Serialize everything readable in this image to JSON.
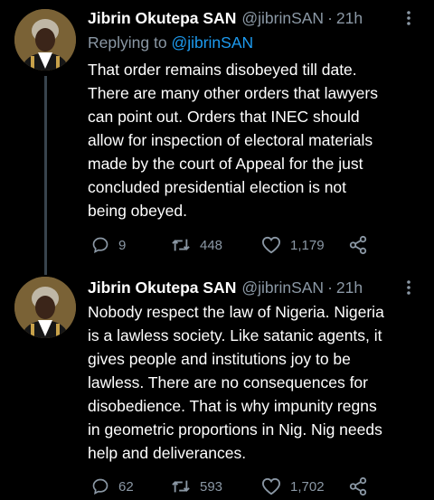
{
  "tweets": [
    {
      "author": {
        "name": "Jibrin Okutepa SAN",
        "handle": "@jibrinSAN"
      },
      "separator": "·",
      "time": "21h",
      "replying_to": {
        "prefix": "Replying to",
        "handle": "@jibrinSAN"
      },
      "text": "That order remains disobeyed till date.\nThere are many other orders that lawyers\ncan point out. Orders that INEC should\nallow for inspection of electoral materials\nmade by the court of Appeal for the just\nconcluded presidential election is not\nbeing obeyed.",
      "stats": {
        "replies": "9",
        "retweets": "448",
        "likes": "1,179"
      }
    },
    {
      "author": {
        "name": "Jibrin Okutepa SAN",
        "handle": "@jibrinSAN"
      },
      "separator": "·",
      "time": "21h",
      "text": "Nobody respect the law of Nigeria. Nigeria\nis a lawless society. Like satanic agents, it\ngives people and institutions joy to be\nlawless. There are no consequences for\ndisobedience. That is why impunity regns\nin geometric proportions in Nig. Nig needs\nhelp and deliverances.",
      "stats": {
        "replies": "62",
        "retweets": "593",
        "likes": "1,702"
      }
    }
  ],
  "icons": {
    "reply": "reply-icon",
    "retweet": "retweet-icon",
    "like": "heart-icon",
    "share": "share-icon",
    "more": "more-vertical-icon"
  },
  "colors": {
    "background": "#000000",
    "text": "#ffffff",
    "secondary": "#8b98a5",
    "link": "#1d9bf0",
    "thread_line": "#38444d"
  }
}
